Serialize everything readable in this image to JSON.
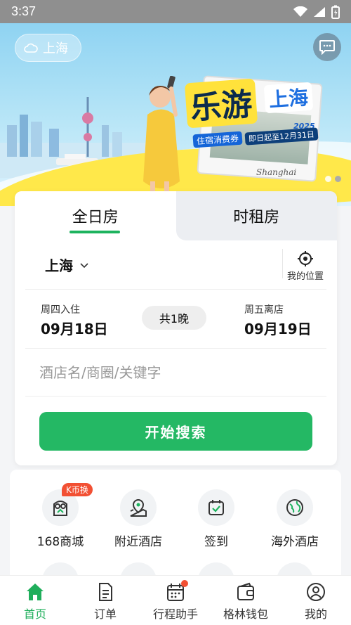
{
  "status_bar": {
    "time": "3:37"
  },
  "banner": {
    "location": "上海",
    "promo_title": "乐游",
    "promo_city": "上海",
    "promo_year": "2025",
    "promo_voucher": "住宿消费券",
    "promo_date": "即日起至12月31日",
    "promo_brand": "Shanghai"
  },
  "search": {
    "tabs": [
      {
        "label": "全日房"
      },
      {
        "label": "时租房"
      }
    ],
    "city": "上海",
    "my_location": "我的位置",
    "checkin_label": "周四入住",
    "checkin_date": "09月18日",
    "nights": "共1晚",
    "checkout_label": "周五离店",
    "checkout_date": "09月19日",
    "keyword_placeholder": "酒店名/商圈/关键字",
    "search_button": "开始搜索"
  },
  "quick_links": [
    {
      "label": "168商城",
      "badge": "K币换",
      "icon": "owl-icon"
    },
    {
      "label": "附近酒店",
      "icon": "map-pin-icon"
    },
    {
      "label": "签到",
      "icon": "calendar-check-icon"
    },
    {
      "label": "海外酒店",
      "icon": "globe-icon"
    }
  ],
  "bottom_nav": [
    {
      "label": "首页",
      "icon": "home-icon",
      "active": true
    },
    {
      "label": "订单",
      "icon": "document-icon"
    },
    {
      "label": "行程助手",
      "icon": "calendar-icon"
    },
    {
      "label": "格林钱包",
      "icon": "wallet-icon"
    },
    {
      "label": "我的",
      "icon": "user-icon"
    }
  ],
  "colors": {
    "accent": "#24b864",
    "badge": "#f25033"
  }
}
